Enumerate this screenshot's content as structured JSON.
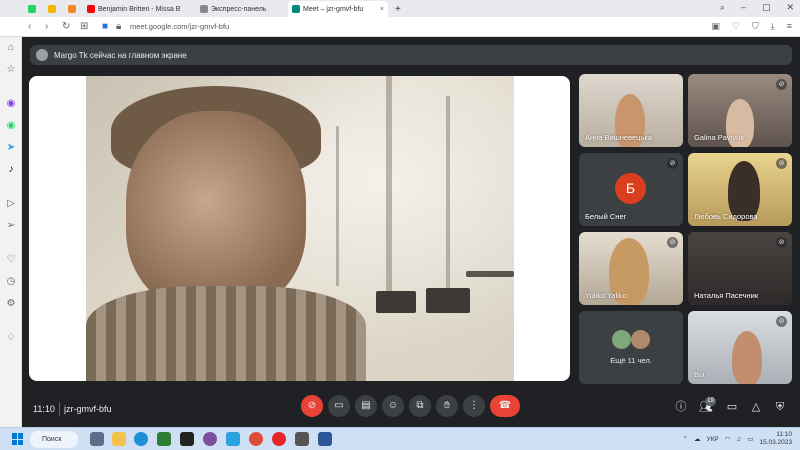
{
  "browser": {
    "tabs": [
      {
        "label": "",
        "icon": "whatsapp-icon"
      },
      {
        "label": "",
        "icon": "store-icon"
      },
      {
        "label": "Benjamin Britten - Missa B",
        "icon": "youtube-icon"
      },
      {
        "label": "Экспресс-панель",
        "icon": "speed-dial-icon"
      },
      {
        "label": "Meet – jzr-gmvf-bfu",
        "icon": "meet-icon"
      }
    ],
    "new_tab": "+",
    "url": "meet.google.com/jzr-gmvf-bfu"
  },
  "meet": {
    "banner_text": "Margo Tk сейчас на главном экране",
    "participants": [
      {
        "name": "Анна Вишневецька",
        "muted": false
      },
      {
        "name": "Galina Pavlyuk",
        "muted": true
      },
      {
        "name": "Белый Снег",
        "muted": true,
        "initial": "Б"
      },
      {
        "name": "Любовь Сидорова",
        "muted": true
      },
      {
        "name": "Yuliko Yaliko",
        "muted": true
      },
      {
        "name": "Наталья Пасечник",
        "muted": true
      },
      {
        "name": "Вы",
        "muted": true
      }
    ],
    "more_label": "Ещё 11 чел.",
    "time": "11:10",
    "meeting_code": "jzr-gmvf-bfu",
    "people_count": "19"
  },
  "taskbar": {
    "search_label": "Поиск",
    "lang": "УКР",
    "time": "11:10",
    "date": "15.03.2023"
  },
  "colors": {
    "meet_bg": "#202124",
    "tile_bg": "#3c4043",
    "end_call": "#ea4335",
    "avatar_b": "#d93f1f",
    "opera_red": "#e5252a"
  }
}
